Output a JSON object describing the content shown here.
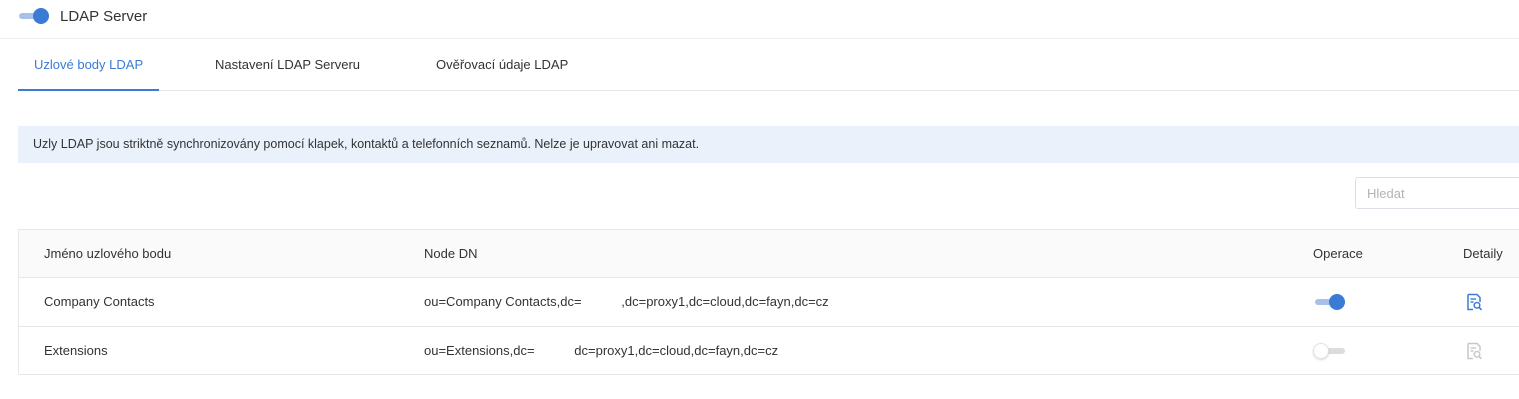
{
  "header": {
    "title": "LDAP Server",
    "toggle_state": "on"
  },
  "tabs": [
    {
      "label": "Uzlové body LDAP",
      "active": true
    },
    {
      "label": "Nastavení LDAP Serveru",
      "active": false
    },
    {
      "label": "Ověřovací údaje LDAP",
      "active": false
    }
  ],
  "notice": {
    "text": "Uzly LDAP jsou striktně synchronizovány pomocí klapek, kontaktů a telefonních seznamů. Nelze je upravovat ani mazat."
  },
  "search": {
    "placeholder": "Hledat"
  },
  "table": {
    "columns": {
      "name": "Jméno uzlového bodu",
      "dn": "Node DN",
      "operation": "Operace",
      "details": "Detaily"
    },
    "rows": [
      {
        "name": "Company Contacts",
        "dn": "ou=Company Contacts,dc=           ,dc=proxy1,dc=cloud,dc=fayn,dc=cz",
        "enabled": true,
        "details_icon": "document-search-icon",
        "details_enabled": true
      },
      {
        "name": "Extensions",
        "dn": "ou=Extensions,dc=           dc=proxy1,dc=cloud,dc=fayn,dc=cz",
        "enabled": false,
        "details_icon": "document-search-icon",
        "details_enabled": false
      }
    ]
  },
  "colors": {
    "accent": "#3a7bd5",
    "accent_light": "#a8c1e8",
    "notice_bg": "#eaf1fb",
    "disabled_icon": "#c8c8c8"
  }
}
